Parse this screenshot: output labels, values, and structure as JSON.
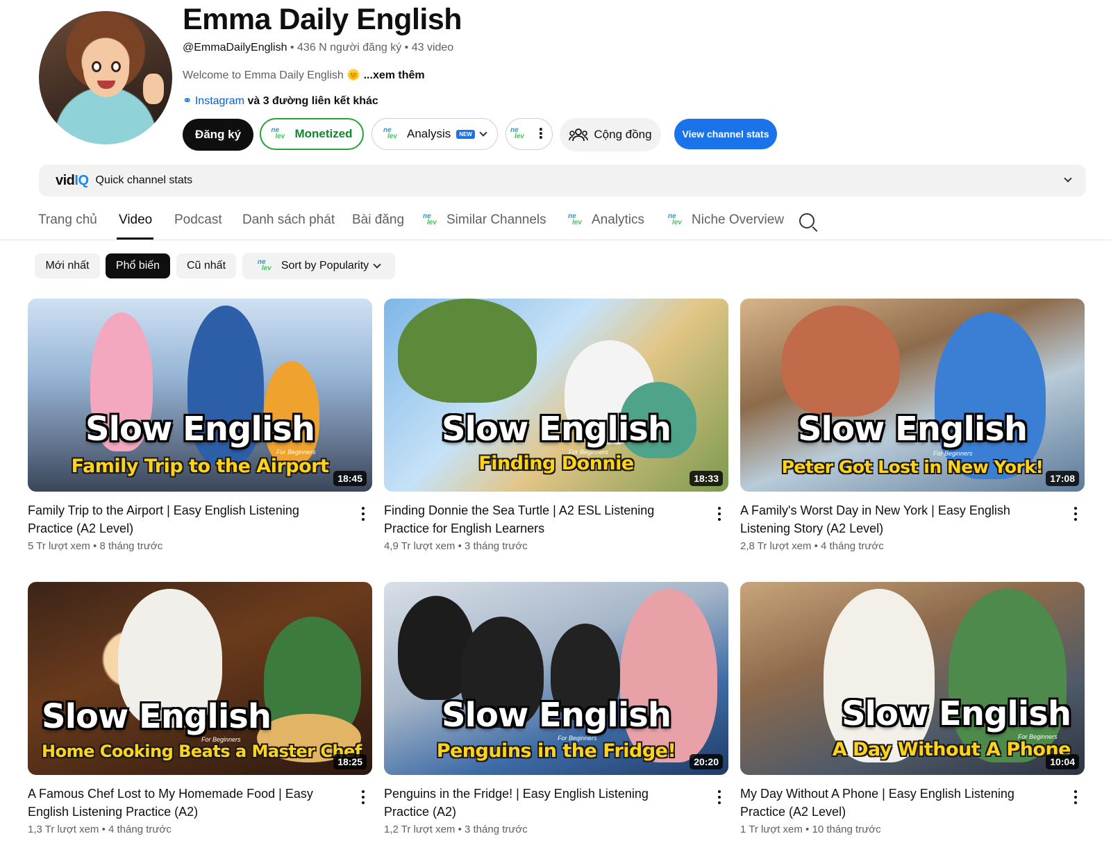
{
  "channel": {
    "title": "Emma Daily English",
    "handle": "@EmmaDailyEnglish",
    "subscribers": "436 N người đăng ký",
    "video_count": "43 video",
    "description": "Welcome to Emma Daily English 🌞",
    "description_more": "...xem thêm",
    "link_label": "Instagram",
    "link_more": "và 3 đường liên kết khác"
  },
  "buttons": {
    "subscribe": "Đăng ký",
    "monetized": "Monetized",
    "analysis": "Analysis",
    "analysis_badge": "NEW",
    "community": "Cộng đồng",
    "view_stats": "View channel stats"
  },
  "vidiq": {
    "logo_a": "vid",
    "logo_b": "IQ",
    "label": "Quick channel stats"
  },
  "tabs": [
    {
      "label": "Trang chủ"
    },
    {
      "label": "Video"
    },
    {
      "label": "Podcast"
    },
    {
      "label": "Danh sách phát"
    },
    {
      "label": "Bài đăng"
    },
    {
      "label": "Similar Channels"
    },
    {
      "label": "Analytics"
    },
    {
      "label": "Niche Overview"
    }
  ],
  "chips": [
    {
      "label": "Mới nhất"
    },
    {
      "label": "Phổ biến"
    },
    {
      "label": "Cũ nhất"
    },
    {
      "label": "Sort by Popularity"
    }
  ],
  "videos": [
    {
      "thumb_big": "Slow English",
      "thumb_sub": "Family Trip to the Airport",
      "thumb_small": "For Beginners",
      "duration": "18:45",
      "title": "Family Trip to the Airport | Easy English Listening Practice (A2 Level)",
      "meta": "5 Tr lượt xem • 8 tháng trước"
    },
    {
      "thumb_big": "Slow English",
      "thumb_sub": "Finding Donnie",
      "thumb_small": "For Beginners",
      "duration": "18:33",
      "title": "Finding Donnie the Sea Turtle | A2 ESL Listening Practice for English Learners",
      "meta": "4,9 Tr lượt xem • 3 tháng trước"
    },
    {
      "thumb_big": "Slow English",
      "thumb_sub": "Peter Got Lost in New York!",
      "thumb_small": "For Beginners",
      "duration": "17:08",
      "title": "A Family's Worst Day in New York | Easy English Listening Story (A2 Level)",
      "meta": "2,8 Tr lượt xem • 4 tháng trước"
    },
    {
      "thumb_big": "Slow English",
      "thumb_sub": "Home Cooking Beats a Master Chef",
      "thumb_small": "For Beginners",
      "duration": "18:25",
      "title": "A Famous Chef Lost to My Homemade Food | Easy English Listening Practice (A2)",
      "meta": "1,3 Tr lượt xem • 4 tháng trước"
    },
    {
      "thumb_big": "Slow English",
      "thumb_sub": "Penguins in the Fridge!",
      "thumb_small": "For Beginners",
      "duration": "20:20",
      "title": "Penguins in the Fridge! | Easy English Listening Practice (A2)",
      "meta": "1,2 Tr lượt xem • 3 tháng trước"
    },
    {
      "thumb_big": "Slow English",
      "thumb_sub": "A Day Without A Phone",
      "thumb_small": "For Beginners",
      "duration": "10:04",
      "title": "My Day Without A Phone | Easy English Listening Practice (A2 Level)",
      "meta": "1 Tr lượt xem • 10 tháng trước"
    }
  ]
}
